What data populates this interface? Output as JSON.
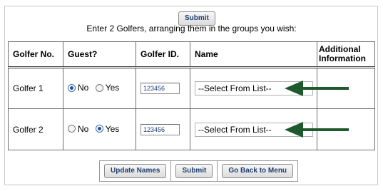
{
  "header": {
    "submit_label": "Submit",
    "instruction": "Enter 2 Golfers, arranging them in the groups you wish:"
  },
  "table": {
    "columns": [
      "Golfer No.",
      "Guest?",
      "Golfer ID.",
      "Name",
      "Additional Information"
    ],
    "rows": [
      {
        "golfer": "Golfer 1",
        "guest_no_label": "No",
        "guest_yes_label": "Yes",
        "guest_selected": "No",
        "golfer_id": "123456",
        "name_select": "--Select From List--"
      },
      {
        "golfer": "Golfer 2",
        "guest_no_label": "No",
        "guest_yes_label": "Yes",
        "guest_selected": "Yes",
        "golfer_id": "123456",
        "name_select": "--Select From List--"
      }
    ]
  },
  "footer": {
    "update_names_label": "Update Names",
    "submit_label": "Submit",
    "back_label": "Go Back to Menu"
  },
  "colors": {
    "arrow": "#1f5a2e",
    "button_text": "#1f3f6f",
    "radio_checked": "#1f4e9a"
  }
}
